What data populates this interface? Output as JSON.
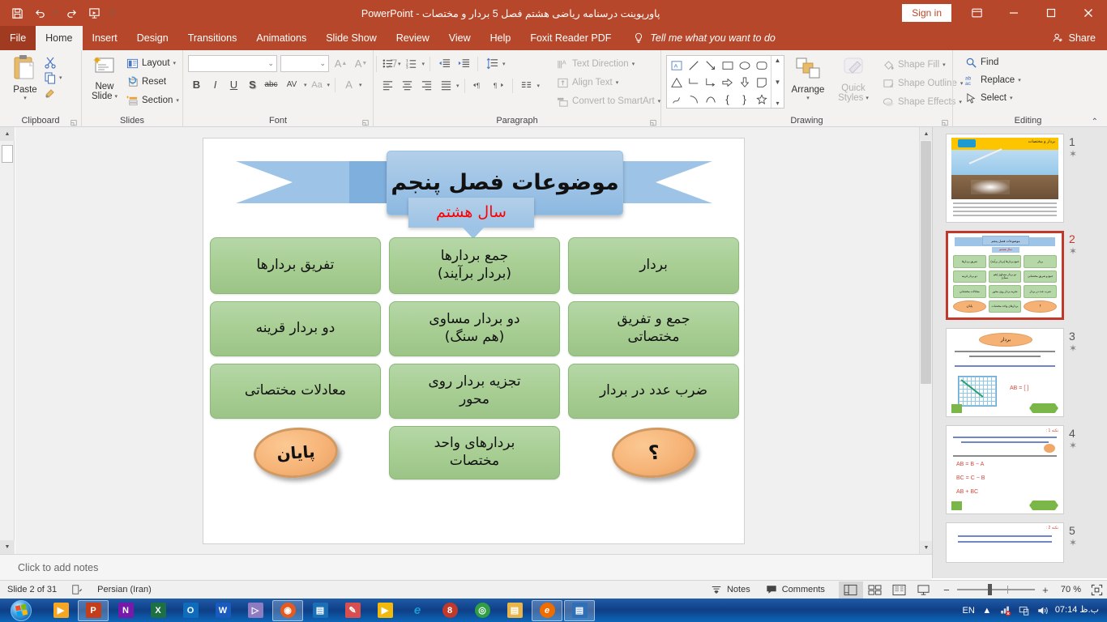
{
  "titlebar": {
    "quick_access": [
      {
        "name": "save-icon",
        "label": "Save"
      },
      {
        "name": "undo-icon",
        "label": "Undo"
      },
      {
        "name": "redo-icon",
        "label": "Redo"
      },
      {
        "name": "start-from-beginning-icon",
        "label": "Start From Beginning"
      },
      {
        "name": "customize-quick-access-toolbar-icon",
        "label": "Customize Quick Access Toolbar"
      }
    ],
    "document_title": "پاورپوینت درسنامه ریاضی هشتم فصل 5 بردار و مختصات  -  PowerPoint",
    "sign_in": "Sign in",
    "ribbon_display_options": "Ribbon Display Options",
    "minimize": "Minimize",
    "restore": "Restore Down",
    "close": "Close"
  },
  "ribbon": {
    "tabs": [
      {
        "label": "File",
        "active": false
      },
      {
        "label": "Home",
        "active": true
      },
      {
        "label": "Insert",
        "active": false
      },
      {
        "label": "Design",
        "active": false
      },
      {
        "label": "Transitions",
        "active": false
      },
      {
        "label": "Animations",
        "active": false
      },
      {
        "label": "Slide Show",
        "active": false
      },
      {
        "label": "Review",
        "active": false
      },
      {
        "label": "View",
        "active": false
      },
      {
        "label": "Help",
        "active": false
      },
      {
        "label": "Foxit Reader PDF",
        "active": false
      }
    ],
    "tell_me": "Tell me what you want to do",
    "share": "Share",
    "groups": {
      "clipboard": {
        "label": "Clipboard",
        "paste": "Paste",
        "cut": "Cut",
        "copy": "Copy",
        "format_painter": "Format Painter"
      },
      "slides": {
        "label": "Slides",
        "new_slide": "New\nSlide",
        "new_slide_line1": "New",
        "new_slide_line2": "Slide",
        "layout": "Layout",
        "reset": "Reset",
        "section": "Section"
      },
      "font": {
        "label": "Font",
        "font_name": "",
        "font_size": "",
        "grow": "Increase Font Size",
        "shrink": "Decrease Font Size",
        "clear_formatting": "Clear All Formatting",
        "bold": "B",
        "italic": "I",
        "underline": "U",
        "shadow": "S",
        "strikethrough": "abc",
        "character_spacing": "AV",
        "change_case": "Aa",
        "font_color": "A"
      },
      "paragraph": {
        "label": "Paragraph",
        "text_direction": "Text Direction",
        "align_text": "Align Text",
        "convert_to_smartart": "Convert to SmartArt"
      },
      "drawing": {
        "label": "Drawing",
        "arrange": "Arrange",
        "quick_styles_line1": "Quick",
        "quick_styles_line2": "Styles",
        "shape_fill": "Shape Fill",
        "shape_outline": "Shape Outline",
        "shape_effects": "Shape Effects"
      },
      "editing": {
        "label": "Editing",
        "find": "Find",
        "replace": "Replace",
        "select": "Select"
      }
    }
  },
  "slide": {
    "banner_title": "موضوعات فصل پنجم",
    "sub_badge": "سال هشتم",
    "sub_badge_color": "#ff0000",
    "box_fill": "#b6d7a8",
    "oval_fill": "#f6b275",
    "banner_fill": "#9dc3e6",
    "rows": [
      [
        {
          "type": "box",
          "text": "تفریق بردارها"
        },
        {
          "type": "box",
          "text": "جمع بردارها\n(بردار برآیند)"
        },
        {
          "type": "box",
          "text": "بردار"
        }
      ],
      [
        {
          "type": "box",
          "text": "دو بردار قرینه"
        },
        {
          "type": "box",
          "text": "دو بردار مساوی\n(هم سنگ)"
        },
        {
          "type": "box",
          "text": "جمع و تفریق\nمختصاتی"
        }
      ],
      [
        {
          "type": "box",
          "text": "معادلات مختصاتی"
        },
        {
          "type": "box",
          "text": "تجزیه بردار روی\nمحور"
        },
        {
          "type": "box",
          "text": "ضرب عدد در بردار"
        }
      ],
      [
        {
          "type": "oval",
          "text": "پایان"
        },
        {
          "type": "box",
          "text": "بردارهای واحد\nمختصات"
        },
        {
          "type": "oval",
          "text": "؟"
        }
      ]
    ]
  },
  "thumbnails": [
    {
      "number": "1",
      "selected": false,
      "banner_text": "بردار و مختصات",
      "chip_text": "فصل 5"
    },
    {
      "number": "2",
      "selected": true,
      "banner_text": "موضوعات فصل پنجم",
      "sub_text": "سال هشتم",
      "boxes": [
        "تفریق بردارها",
        "جمع بردارها (بردار برآیند)",
        "بردار",
        "دو بردار قرینه",
        "دو بردار مساوی (هم سنگ)",
        "جمع و تفریق مختصاتی",
        "معادلات مختصاتی",
        "تجزیه بردار روی محور",
        "ضرب عدد در بردار",
        "پایان",
        "بردارهای واحد مختصات",
        "؟"
      ]
    },
    {
      "number": "3",
      "selected": false,
      "title": "بردار",
      "equation": "AB = [ ]"
    },
    {
      "number": "4",
      "selected": false,
      "title": "نکته 1 :",
      "eq1": "AB = B − A",
      "eq2": "BC = C − B",
      "eq3": "AB + BC"
    },
    {
      "number": "5",
      "selected": false,
      "title": "نکته 2 :"
    }
  ],
  "notes": {
    "placeholder": "Click to add notes"
  },
  "statusbar": {
    "slide_counter": "Slide 2 of 31",
    "language": "Persian (Iran)",
    "accessibility_icon": "accessibility-checker-icon",
    "notes": "Notes",
    "comments": "Comments",
    "views": [
      {
        "name": "normal-view",
        "active": true
      },
      {
        "name": "slide-sorter-view",
        "active": false
      },
      {
        "name": "reading-view",
        "active": false
      },
      {
        "name": "slide-show-view",
        "active": false
      }
    ],
    "zoom_out": "−",
    "zoom_in": "+",
    "zoom_percent": "70 %",
    "fit_to_window": "Fit slide to current window"
  },
  "taskbar": {
    "start": "Start",
    "apps": [
      {
        "name": "media-player-app",
        "glyph": "▶",
        "color": "#f5a623",
        "open": false
      },
      {
        "name": "powerpoint-app",
        "glyph": "P",
        "color": "#c43e1c",
        "open": true
      },
      {
        "name": "onenote-app",
        "glyph": "N",
        "color": "#7719aa",
        "open": false
      },
      {
        "name": "excel-app",
        "glyph": "X",
        "color": "#1d7044",
        "open": false
      },
      {
        "name": "outlook-app",
        "glyph": "O",
        "color": "#0f6cbd",
        "open": false
      },
      {
        "name": "word-app",
        "glyph": "W",
        "color": "#185abd",
        "open": false
      },
      {
        "name": "movie-maker-app",
        "glyph": "▷",
        "color": "#8e7cc3",
        "open": false
      },
      {
        "name": "firefox-app",
        "glyph": "◉",
        "color": "#e55b1f",
        "open": true
      },
      {
        "name": "sticky-notes-app",
        "glyph": "▤",
        "color": "#1a6fb5",
        "open": false
      },
      {
        "name": "paint-app",
        "glyph": "✎",
        "color": "#d94f4f",
        "open": false
      },
      {
        "name": "vlc-app",
        "glyph": "▶",
        "color": "#f0b90b",
        "open": false
      },
      {
        "name": "internet-explorer-app",
        "glyph": "e",
        "color": "#1a9bd7",
        "open": false
      },
      {
        "name": "bitcomet-app",
        "glyph": "❽",
        "color": "#c0392b",
        "open": false
      },
      {
        "name": "chrome-app",
        "glyph": "◎",
        "color": "#2f9e44",
        "open": false
      },
      {
        "name": "file-explorer-app",
        "glyph": "▤",
        "color": "#e8b54a",
        "open": false
      },
      {
        "name": "browser-app",
        "glyph": "e",
        "color": "#ef6c00",
        "open": true
      },
      {
        "name": "library-app",
        "glyph": "▤",
        "color": "#2f6fb5",
        "open": true
      }
    ],
    "language_indicator": "EN",
    "tray_icons": [
      "show-hidden-icons",
      "network-error-icon",
      "display-icon",
      "volume-icon"
    ],
    "clock_time": "07:14 ب.ظ"
  }
}
